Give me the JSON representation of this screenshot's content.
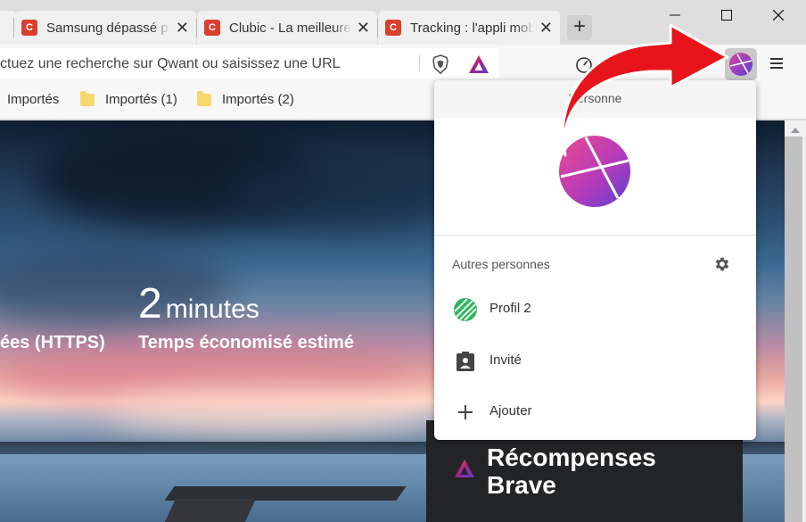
{
  "tabs": [
    {
      "favicon": "C",
      "title": "Samsung dépassé par",
      "close": "✕"
    },
    {
      "favicon": "C",
      "title": "Clubic - La meilleure",
      "close": "✕"
    },
    {
      "favicon": "C",
      "title": "Tracking : l'appli mobile",
      "close": "✕"
    }
  ],
  "first_tab_close": "✕",
  "new_tab": "+",
  "window_controls": {
    "minimize": "—",
    "maximize": "☐",
    "close": "✕"
  },
  "address_bar": {
    "text": "ctuez une recherche sur Qwant ou saisissez une URL"
  },
  "bookmarks": [
    {
      "label": "Importés"
    },
    {
      "label": "Importés (1)"
    },
    {
      "label": "Importés (2)"
    }
  ],
  "stats": {
    "value": "2",
    "unit": "minutes",
    "label": "Temps économisé estimé",
    "left_label": "ées (HTTPS)"
  },
  "rewards": {
    "title": "Récompenses Brave"
  },
  "profile_popup": {
    "header": "Personne",
    "others_label": "Autres personnes",
    "items": [
      {
        "label": "Profil 2",
        "icon": "profile-2-avatar-icon"
      },
      {
        "label": "Invité",
        "icon": "guest-icon"
      },
      {
        "label": "Ajouter",
        "icon": "add-icon"
      }
    ]
  },
  "colors": {
    "annotation_arrow": "#e8141c",
    "avatar_gradient_start": "#d33bb0",
    "avatar_gradient_end": "#5a3fd6",
    "brave_orange": "#fb542b",
    "tab_favicon": "#d8412f"
  }
}
